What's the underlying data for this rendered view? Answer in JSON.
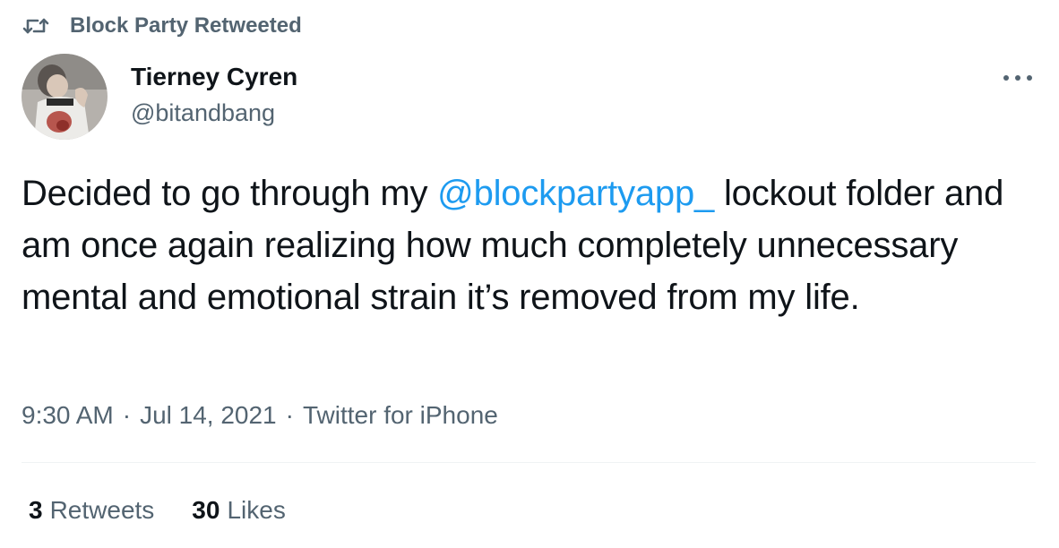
{
  "social_context": {
    "text": "Block Party Retweeted",
    "icon": "retweet-icon"
  },
  "author": {
    "name": "Tierney Cyren",
    "handle": "@bitandbang",
    "avatar_icon": "avatar-photo"
  },
  "tweet": {
    "text_before": "Decided to go through my ",
    "mention": "@blockpartyapp_",
    "text_after": " lockout folder and am once again realizing how much completely unnecessary mental and emotional strain it’s removed from my life.",
    "time": "9:30 AM",
    "date": "Jul 14, 2021",
    "source": "Twitter for iPhone",
    "separator": "·"
  },
  "stats": {
    "retweets_count": "3",
    "retweets_label": "Retweets",
    "likes_count": "30",
    "likes_label": "Likes"
  },
  "colors": {
    "link": "#1d9bf0",
    "secondary_text": "#536471",
    "primary_text": "#0f1419",
    "divider": "#eff3f4"
  }
}
